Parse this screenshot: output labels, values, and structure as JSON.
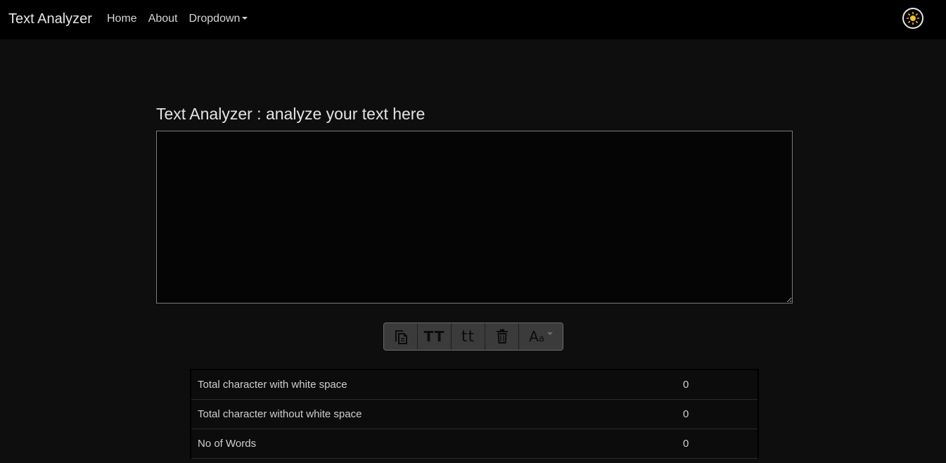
{
  "navbar": {
    "brand": "Text Analyzer",
    "links": [
      "Home",
      "About",
      "Dropdown"
    ],
    "theme_toggle_icon": "sun-icon"
  },
  "main": {
    "heading": "Text Analyzer : analyze your text here",
    "textarea": {
      "value": "",
      "placeholder": ""
    },
    "toolbar": {
      "buttons": [
        {
          "icon": "copy-icon"
        },
        {
          "icon": "uppercase-icon",
          "label": "TT"
        },
        {
          "icon": "lowercase-icon",
          "label": "tt"
        },
        {
          "icon": "trash-icon"
        },
        {
          "icon": "font-case-dropdown-icon",
          "label_large": "A",
          "label_small": "a"
        }
      ]
    },
    "stats": [
      {
        "label": "Total character with white space",
        "value": "0"
      },
      {
        "label": "Total character without white space",
        "value": "0"
      },
      {
        "label": "No of Words",
        "value": "0"
      }
    ]
  },
  "colors": {
    "navbar_bg": "#000000",
    "page_bg": "#0e0e0e",
    "sun_color": "#f2c029"
  }
}
